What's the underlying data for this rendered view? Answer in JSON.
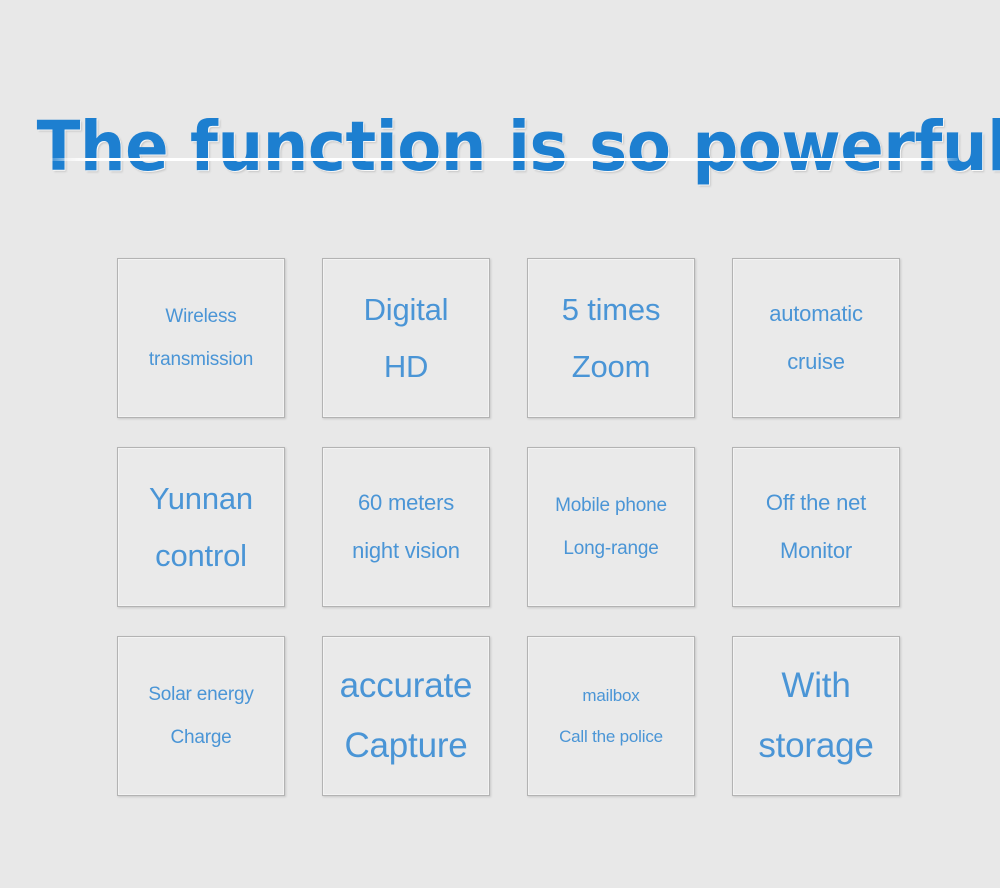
{
  "header": {
    "title": "The function is so powerful"
  },
  "divider": {
    "name": "title-divider"
  },
  "colors": {
    "background": "#e8e8e8",
    "title_blue": "#1d7fd0",
    "card_text_blue": "#4a95d6",
    "card_border": "#b3b3b3",
    "card_fill": "#eaeaea",
    "divider": "#ffffff"
  },
  "features": [
    {
      "id": "wireless-transmission",
      "line1": "Wireless",
      "line2": "transmission",
      "size": "sm"
    },
    {
      "id": "digital-hd",
      "line1": "Digital",
      "line2": "HD",
      "size": "xl"
    },
    {
      "id": "five-times-zoom",
      "line1": "5 times",
      "line2": "Zoom",
      "size": "xl"
    },
    {
      "id": "automatic-cruise",
      "line1": "automatic",
      "line2": "cruise",
      "size": "md"
    },
    {
      "id": "yunnan-control",
      "line1": "Yunnan",
      "line2": "control",
      "size": "xl"
    },
    {
      "id": "sixty-meters-night-vision",
      "line1": "60 meters",
      "line2": "night vision",
      "size": "md"
    },
    {
      "id": "mobile-phone-long-range",
      "line1": "Mobile phone",
      "line2": "Long-range",
      "size": "sm"
    },
    {
      "id": "off-the-net-monitor",
      "line1": "Off the net",
      "line2": "Monitor",
      "size": "md"
    },
    {
      "id": "solar-energy-charge",
      "line1": "Solar energy",
      "line2": "Charge",
      "size": "sm"
    },
    {
      "id": "accurate-capture",
      "line1": "accurate",
      "line2": "Capture",
      "size": "xxl"
    },
    {
      "id": "mailbox-call-the-police",
      "line1": "mailbox",
      "line2": "Call the police",
      "size": "xs"
    },
    {
      "id": "with-storage",
      "line1": "With",
      "line2": "storage",
      "size": "xxl"
    }
  ]
}
